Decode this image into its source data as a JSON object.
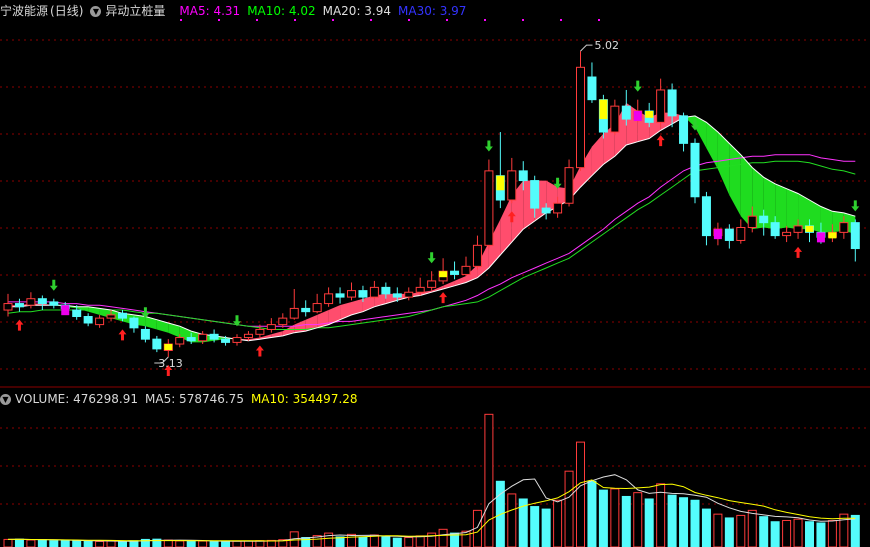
{
  "header": {
    "stock_name": "宁波能源",
    "period": "(日线)",
    "indicator_name": "异动立桩量",
    "ma": [
      {
        "label": "MA5: 4.31",
        "color": "#ff00ff"
      },
      {
        "label": "MA10: 4.02",
        "color": "#00ff00"
      },
      {
        "label": "MA20: 3.94",
        "color": "#dddddd"
      },
      {
        "label": "MA30: 3.97",
        "color": "#3333ff"
      }
    ]
  },
  "volume_header": {
    "label": "VOLUME: 476298.91",
    "ma5": "MA5: 578746.75",
    "ma10": "MA10: 354497.28",
    "ma5_color": "#dddddd",
    "ma10_color": "#ffff00"
  },
  "annotations": {
    "high": "5.02",
    "low": "3.13"
  },
  "colors": {
    "up": "#ff3b3b",
    "down": "#54fcfc",
    "ribbon_up": "#ff4d6d",
    "ribbon_down": "#1fdc1f",
    "grid": "#8b0000",
    "signal_yellow": "#ffff00",
    "signal_magenta": "#ee00ee",
    "arrow_up": "#ff2020",
    "arrow_down": "#2fd02f"
  },
  "chart_data": {
    "type": "candlestick",
    "ylim": [
      3.0,
      5.2
    ],
    "volume_ylim": [
      0,
      1100000
    ],
    "candles": [
      [
        3.42,
        3.46,
        3.52,
        3.38
      ],
      [
        3.46,
        3.44,
        3.49,
        3.41
      ],
      [
        3.45,
        3.49,
        3.53,
        3.43
      ],
      [
        3.49,
        3.46,
        3.51,
        3.42
      ],
      [
        3.47,
        3.45,
        3.49,
        3.43
      ],
      [
        3.45,
        3.43,
        3.47,
        3.39
      ],
      [
        3.42,
        3.38,
        3.45,
        3.36
      ],
      [
        3.38,
        3.34,
        3.4,
        3.32
      ],
      [
        3.33,
        3.37,
        3.39,
        3.31
      ],
      [
        3.37,
        3.39,
        3.42,
        3.35
      ],
      [
        3.4,
        3.37,
        3.42,
        3.35
      ],
      [
        3.37,
        3.31,
        3.38,
        3.28
      ],
      [
        3.3,
        3.24,
        3.32,
        3.22
      ],
      [
        3.24,
        3.18,
        3.26,
        3.16
      ],
      [
        3.17,
        3.21,
        3.24,
        3.13
      ],
      [
        3.21,
        3.25,
        3.27,
        3.19
      ],
      [
        3.25,
        3.23,
        3.28,
        3.21
      ],
      [
        3.23,
        3.27,
        3.29,
        3.21
      ],
      [
        3.27,
        3.24,
        3.3,
        3.22
      ],
      [
        3.24,
        3.22,
        3.26,
        3.2
      ],
      [
        3.22,
        3.25,
        3.27,
        3.2
      ],
      [
        3.25,
        3.27,
        3.29,
        3.23
      ],
      [
        3.27,
        3.3,
        3.33,
        3.25
      ],
      [
        3.3,
        3.33,
        3.37,
        3.28
      ],
      [
        3.33,
        3.37,
        3.4,
        3.31
      ],
      [
        3.37,
        3.43,
        3.55,
        3.36
      ],
      [
        3.43,
        3.41,
        3.48,
        3.38
      ],
      [
        3.41,
        3.46,
        3.52,
        3.4
      ],
      [
        3.46,
        3.52,
        3.56,
        3.44
      ],
      [
        3.52,
        3.5,
        3.56,
        3.46
      ],
      [
        3.5,
        3.54,
        3.59,
        3.48
      ],
      [
        3.54,
        3.5,
        3.57,
        3.47
      ],
      [
        3.5,
        3.56,
        3.6,
        3.49
      ],
      [
        3.56,
        3.52,
        3.59,
        3.49
      ],
      [
        3.52,
        3.5,
        3.56,
        3.47
      ],
      [
        3.5,
        3.53,
        3.56,
        3.48
      ],
      [
        3.53,
        3.56,
        3.62,
        3.51
      ],
      [
        3.56,
        3.6,
        3.66,
        3.54
      ],
      [
        3.6,
        3.66,
        3.74,
        3.58
      ],
      [
        3.66,
        3.64,
        3.72,
        3.61
      ],
      [
        3.64,
        3.69,
        3.75,
        3.63
      ],
      [
        3.69,
        3.82,
        3.88,
        3.67
      ],
      [
        3.82,
        4.28,
        4.35,
        3.8
      ],
      [
        4.25,
        4.1,
        4.52,
        4.05
      ],
      [
        4.1,
        4.28,
        4.36,
        4.08
      ],
      [
        4.28,
        4.22,
        4.34,
        4.16
      ],
      [
        4.22,
        4.05,
        4.25,
        3.99
      ],
      [
        4.05,
        4.02,
        4.08,
        3.98
      ],
      [
        4.02,
        4.08,
        4.12,
        3.99
      ],
      [
        4.08,
        4.3,
        4.35,
        4.06
      ],
      [
        4.3,
        4.92,
        5.02,
        4.28
      ],
      [
        4.86,
        4.72,
        4.95,
        4.7
      ],
      [
        4.72,
        4.52,
        4.75,
        4.48
      ],
      [
        4.52,
        4.68,
        4.72,
        4.5
      ],
      [
        4.68,
        4.6,
        4.78,
        4.56
      ],
      [
        4.6,
        4.65,
        4.72,
        4.58
      ],
      [
        4.65,
        4.58,
        4.7,
        4.55
      ],
      [
        4.58,
        4.78,
        4.85,
        4.55
      ],
      [
        4.78,
        4.62,
        4.82,
        4.55
      ],
      [
        4.62,
        4.45,
        4.64,
        4.4
      ],
      [
        4.45,
        4.12,
        4.48,
        4.08
      ],
      [
        4.12,
        3.88,
        4.15,
        3.82
      ],
      [
        3.88,
        3.92,
        3.96,
        3.82
      ],
      [
        3.92,
        3.85,
        3.95,
        3.8
      ],
      [
        3.85,
        3.93,
        3.98,
        3.83
      ],
      [
        3.93,
        4.0,
        4.06,
        3.9
      ],
      [
        4.0,
        3.96,
        4.04,
        3.88
      ],
      [
        3.96,
        3.88,
        4.0,
        3.86
      ],
      [
        3.88,
        3.9,
        3.94,
        3.84
      ],
      [
        3.9,
        3.94,
        3.98,
        3.86
      ],
      [
        3.94,
        3.9,
        3.98,
        3.84
      ],
      [
        3.9,
        3.87,
        3.96,
        3.83
      ],
      [
        3.87,
        3.9,
        3.95,
        3.84
      ],
      [
        3.9,
        3.96,
        4.0,
        3.86
      ],
      [
        3.96,
        3.8,
        3.98,
        3.72
      ]
    ],
    "volumes": [
      60000,
      62000,
      55000,
      58000,
      50000,
      52000,
      48000,
      46000,
      44000,
      47000,
      45000,
      49000,
      60000,
      62000,
      55000,
      48000,
      45000,
      47000,
      44000,
      42000,
      46000,
      48000,
      50000,
      52000,
      58000,
      120000,
      75000,
      90000,
      110000,
      80000,
      100000,
      78000,
      95000,
      80000,
      70000,
      75000,
      88000,
      110000,
      140000,
      110000,
      125000,
      290000,
      1050000,
      520000,
      420000,
      380000,
      320000,
      300000,
      370000,
      600000,
      830000,
      520000,
      450000,
      460000,
      400000,
      430000,
      380000,
      500000,
      410000,
      390000,
      370000,
      300000,
      260000,
      230000,
      250000,
      290000,
      240000,
      200000,
      210000,
      220000,
      200000,
      190000,
      210000,
      260000,
      250000
    ],
    "ma5": [
      3.45,
      3.45,
      3.46,
      3.46,
      3.45,
      3.44,
      3.43,
      3.41,
      3.39,
      3.37,
      3.35,
      3.33,
      3.32,
      3.3,
      3.28,
      3.25,
      3.22,
      3.22,
      3.23,
      3.24,
      3.24,
      3.24,
      3.25,
      3.27,
      3.29,
      3.33,
      3.36,
      3.39,
      3.42,
      3.45,
      3.47,
      3.49,
      3.51,
      3.52,
      3.52,
      3.52,
      3.53,
      3.54,
      3.57,
      3.6,
      3.63,
      3.7,
      3.84,
      3.98,
      4.13,
      4.22,
      4.22,
      4.22,
      4.18,
      4.17,
      4.31,
      4.43,
      4.51,
      4.57,
      4.7,
      4.65,
      4.61,
      4.64,
      4.64,
      4.62,
      4.55,
      4.42,
      4.29,
      4.13,
      4.0,
      3.92,
      3.93,
      3.92,
      3.93,
      3.92,
      3.92,
      3.9,
      3.9,
      3.91,
      3.89
    ],
    "ma10": [
      3.44,
      3.44,
      3.45,
      3.45,
      3.45,
      3.45,
      3.44,
      3.44,
      3.43,
      3.42,
      3.4,
      3.39,
      3.38,
      3.36,
      3.34,
      3.32,
      3.29,
      3.27,
      3.26,
      3.25,
      3.24,
      3.23,
      3.24,
      3.25,
      3.26,
      3.28,
      3.29,
      3.31,
      3.33,
      3.36,
      3.39,
      3.41,
      3.44,
      3.46,
      3.48,
      3.5,
      3.51,
      3.53,
      3.55,
      3.57,
      3.59,
      3.62,
      3.68,
      3.76,
      3.84,
      3.92,
      3.97,
      4.02,
      4.06,
      4.1,
      4.18,
      4.25,
      4.32,
      4.37,
      4.44,
      4.46,
      4.48,
      4.53,
      4.57,
      4.61,
      4.62,
      4.58,
      4.52,
      4.45,
      4.38,
      4.3,
      4.24,
      4.2,
      4.17,
      4.14,
      4.1,
      4.06,
      4.03,
      4.02,
      4.0
    ],
    "ma20": [
      3.4,
      3.41,
      3.41,
      3.42,
      3.42,
      3.42,
      3.42,
      3.42,
      3.42,
      3.42,
      3.42,
      3.41,
      3.4,
      3.4,
      3.39,
      3.38,
      3.37,
      3.36,
      3.35,
      3.34,
      3.33,
      3.32,
      3.31,
      3.3,
      3.3,
      3.3,
      3.3,
      3.31,
      3.31,
      3.32,
      3.33,
      3.34,
      3.35,
      3.36,
      3.37,
      3.38,
      3.4,
      3.42,
      3.44,
      3.45,
      3.46,
      3.47,
      3.5,
      3.54,
      3.58,
      3.62,
      3.65,
      3.68,
      3.71,
      3.74,
      3.79,
      3.84,
      3.89,
      3.94,
      3.99,
      4.04,
      4.08,
      4.13,
      4.18,
      4.23,
      4.28,
      4.29,
      4.3,
      4.31,
      4.32,
      4.33,
      4.33,
      4.34,
      4.34,
      4.34,
      4.33,
      4.31,
      4.29,
      4.28,
      4.26
    ],
    "ma30": [
      3.47,
      3.47,
      3.47,
      3.47,
      3.47,
      3.46,
      3.46,
      3.45,
      3.45,
      3.44,
      3.43,
      3.42,
      3.41,
      3.4,
      3.39,
      3.38,
      3.37,
      3.36,
      3.35,
      3.34,
      3.33,
      3.32,
      3.32,
      3.32,
      3.32,
      3.32,
      3.33,
      3.33,
      3.34,
      3.35,
      3.35,
      3.36,
      3.37,
      3.38,
      3.39,
      3.4,
      3.41,
      3.42,
      3.44,
      3.46,
      3.48,
      3.51,
      3.55,
      3.58,
      3.62,
      3.65,
      3.68,
      3.71,
      3.74,
      3.77,
      3.82,
      3.87,
      3.92,
      3.98,
      4.03,
      4.08,
      4.12,
      4.18,
      4.23,
      4.28,
      4.31,
      4.33,
      4.34,
      4.35,
      4.36,
      4.37,
      4.37,
      4.38,
      4.38,
      4.38,
      4.38,
      4.36,
      4.35,
      4.34,
      4.34
    ],
    "up_arrows": [
      1,
      10,
      14,
      22,
      38,
      44,
      57,
      69
    ],
    "down_arrows": [
      4,
      12,
      20,
      37,
      42,
      48,
      55,
      60,
      74
    ],
    "yellow_markers": [
      14,
      38,
      43,
      52,
      56,
      70,
      72
    ],
    "magenta_markers": [
      5,
      55,
      62,
      71
    ]
  }
}
